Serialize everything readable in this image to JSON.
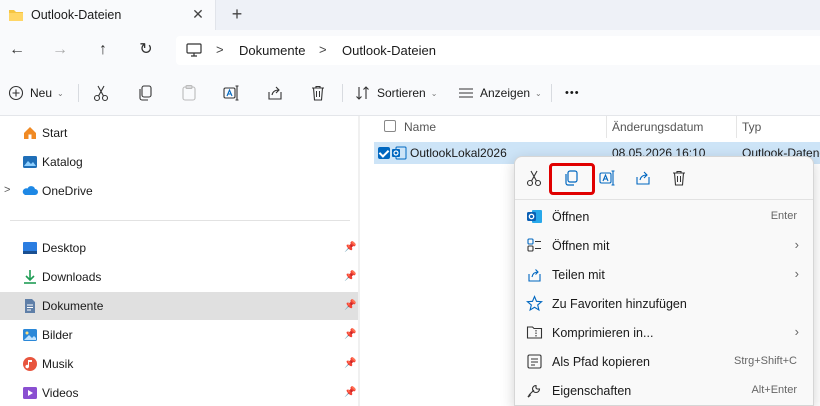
{
  "window": {
    "tab_title": "Outlook-Dateien",
    "tab_close": "✕",
    "new_tab": "+"
  },
  "nav": {
    "back": "←",
    "forward": "→",
    "up": "↑",
    "refresh": "↻",
    "breadcrumb_separator": ">",
    "breadcrumbs": [
      "Dokumente",
      "Outlook-Dateien"
    ]
  },
  "toolbar": {
    "new_label": "Neu",
    "sort_label": "Sortieren",
    "view_label": "Anzeigen",
    "more_label": "•••",
    "caret": "⌄"
  },
  "sidebar": {
    "expander": ">",
    "pin": "📌",
    "top_items": [
      {
        "label": "Start",
        "icon": "home-icon"
      },
      {
        "label": "Katalog",
        "icon": "gallery-icon"
      },
      {
        "label": "OneDrive",
        "icon": "cloud-icon"
      }
    ],
    "quick_items": [
      {
        "label": "Desktop",
        "icon": "desktop-icon"
      },
      {
        "label": "Downloads",
        "icon": "download-icon"
      },
      {
        "label": "Dokumente",
        "icon": "documents-icon",
        "selected": true
      },
      {
        "label": "Bilder",
        "icon": "pictures-icon"
      },
      {
        "label": "Musik",
        "icon": "music-icon"
      },
      {
        "label": "Videos",
        "icon": "videos-icon"
      }
    ]
  },
  "files": {
    "columns": [
      "Name",
      "Änderungsdatum",
      "Typ"
    ],
    "rows": [
      {
        "name": "OutlookLokal2026",
        "date": "08.05.2026 16:10",
        "type": "Outlook-Datendatei",
        "selected": true
      }
    ]
  },
  "context_menu": {
    "items": [
      {
        "label": "Öffnen",
        "accel": "Enter",
        "icon": "outlook-icon"
      },
      {
        "label": "Öffnen mit",
        "submenu": "›",
        "icon": "open-with-icon"
      },
      {
        "label": "Teilen mit",
        "submenu": "›",
        "icon": "share-icon"
      },
      {
        "label": "Zu Favoriten hinzufügen",
        "icon": "star-icon"
      },
      {
        "label": "Komprimieren in...",
        "submenu": "›",
        "icon": "archive-icon"
      },
      {
        "label": "Als Pfad kopieren",
        "accel": "Strg+Shift+C",
        "icon": "copy-path-icon"
      },
      {
        "label": "Eigenschaften",
        "accel": "Alt+Enter",
        "icon": "properties-icon"
      }
    ]
  },
  "colors": {
    "accent": "#0067c0",
    "highlight": "#e00000",
    "selection": "#cde4f7",
    "sidebar_selected": "#e0e0e0"
  }
}
